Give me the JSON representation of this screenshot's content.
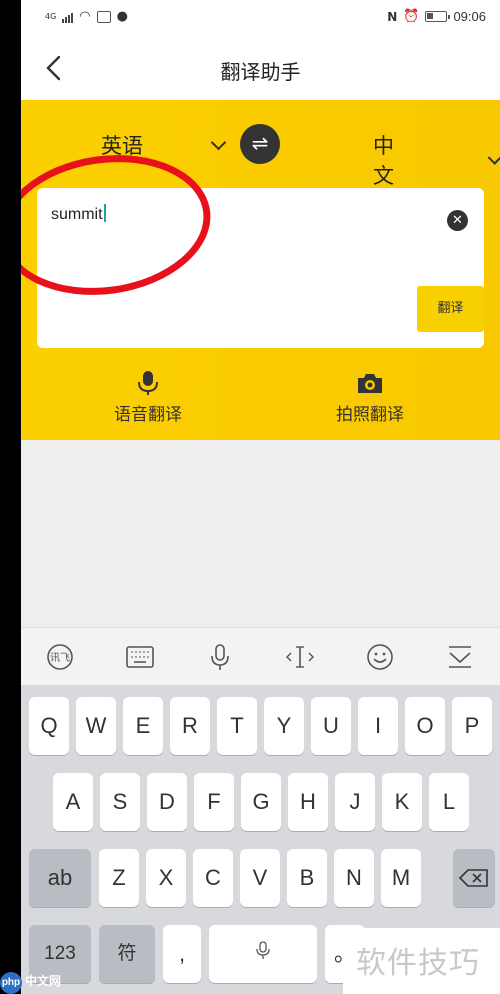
{
  "status_bar": {
    "time": "09:06",
    "network": "4G"
  },
  "header": {
    "title": "翻译助手"
  },
  "languages": {
    "source": "英语",
    "target": "中文"
  },
  "input": {
    "value": "summit"
  },
  "translate_button": {
    "label": "翻译"
  },
  "features": [
    {
      "label": "语音翻译",
      "icon": "microphone-icon"
    },
    {
      "label": "拍照翻译",
      "icon": "camera-icon"
    }
  ],
  "keyboard": {
    "row1": [
      "Q",
      "W",
      "E",
      "R",
      "T",
      "Y",
      "U",
      "I",
      "O",
      "P"
    ],
    "row2": [
      "A",
      "S",
      "D",
      "F",
      "G",
      "H",
      "J",
      "K",
      "L"
    ],
    "row3": [
      "Z",
      "X",
      "C",
      "V",
      "B",
      "N",
      "M"
    ],
    "shift_label": "ab",
    "numbers_label": "123",
    "symbols_label": "符",
    "comma_label": ",",
    "period_label": "。"
  },
  "toolbar_icons": [
    "iflytek-logo-icon",
    "keyboard-icon",
    "microphone-icon",
    "cursor-icon",
    "emoji-icon",
    "collapse-keyboard-icon"
  ],
  "watermark": {
    "text": "软件技巧",
    "site": "中文网",
    "logo": "php"
  },
  "colors": {
    "accent": "#f8c800",
    "annotation": "#e8101a",
    "dark": "#333333"
  }
}
